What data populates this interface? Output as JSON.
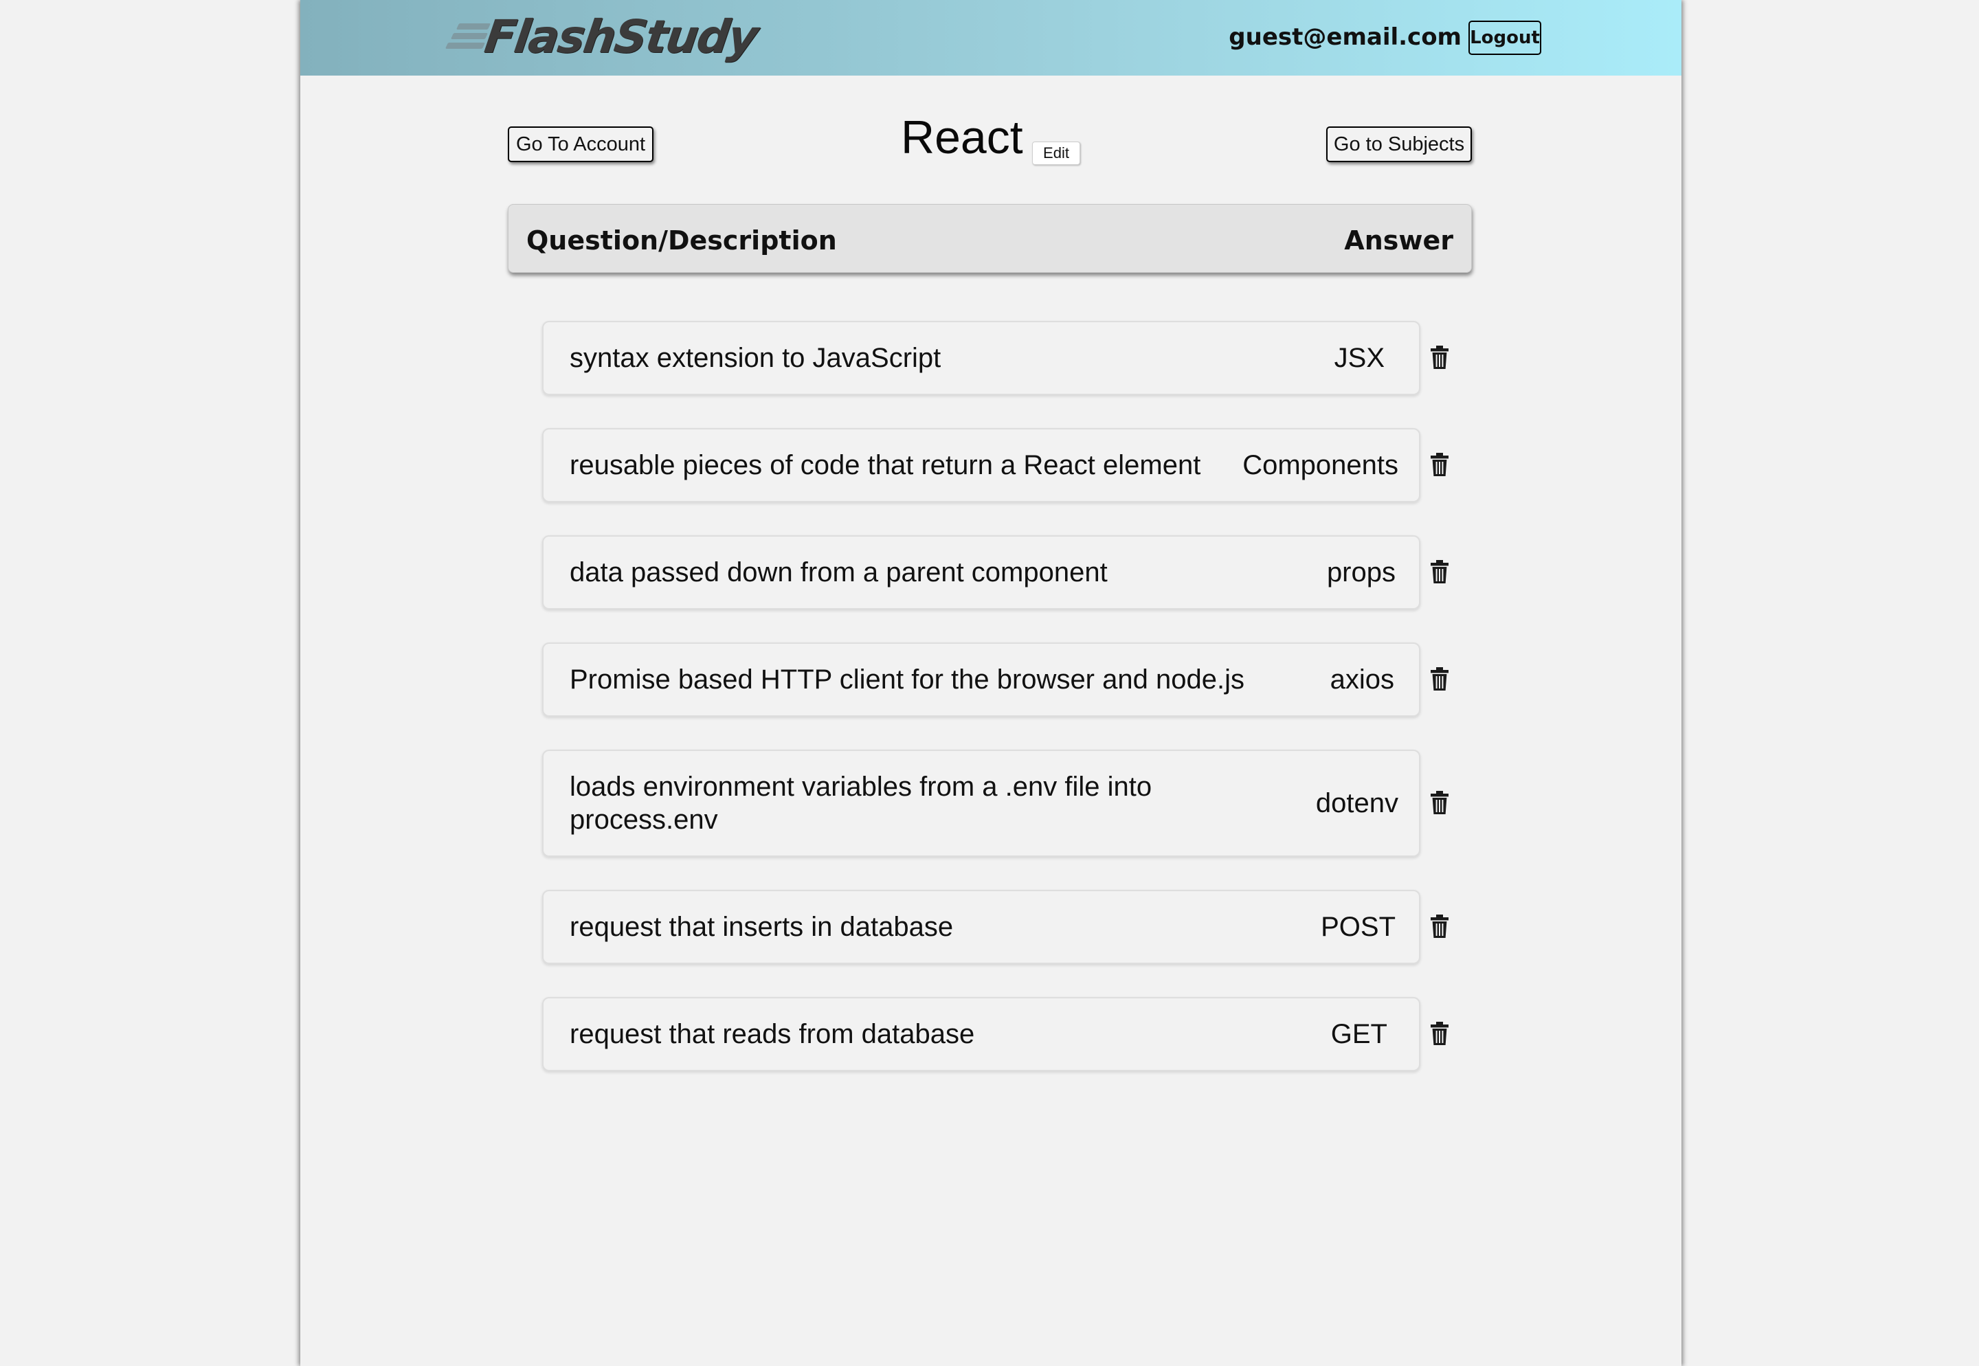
{
  "header": {
    "logo_text": "FlashStudy",
    "user_email": "guest@email.com",
    "logout_label": "Logout"
  },
  "controls": {
    "account_label": "Go To Account",
    "subjects_label": "Go to Subjects",
    "subject_title": "React",
    "edit_label": "Edit"
  },
  "table": {
    "question_header": "Question/Description",
    "answer_header": "Answer",
    "cards": [
      {
        "question": "syntax extension to JavaScript",
        "answer": "JSX"
      },
      {
        "question": "reusable pieces of code that return a React element",
        "answer": "Components"
      },
      {
        "question": "data passed down from a parent component",
        "answer": "props"
      },
      {
        "question": "Promise based HTTP client for the browser and node.js",
        "answer": "axios"
      },
      {
        "question": "loads environment variables from a .env file into process.env",
        "answer": "dotenv"
      },
      {
        "question": "request that inserts in database",
        "answer": "POST"
      },
      {
        "question": "request that reads from database",
        "answer": "GET"
      }
    ]
  },
  "icons": {
    "delete": "trash-icon"
  },
  "colors": {
    "header_gradient_start": "#83b1bd",
    "header_gradient_end": "#aaecf9",
    "page_background": "#f2f2f2",
    "column_header_background": "#e3e3e3"
  }
}
